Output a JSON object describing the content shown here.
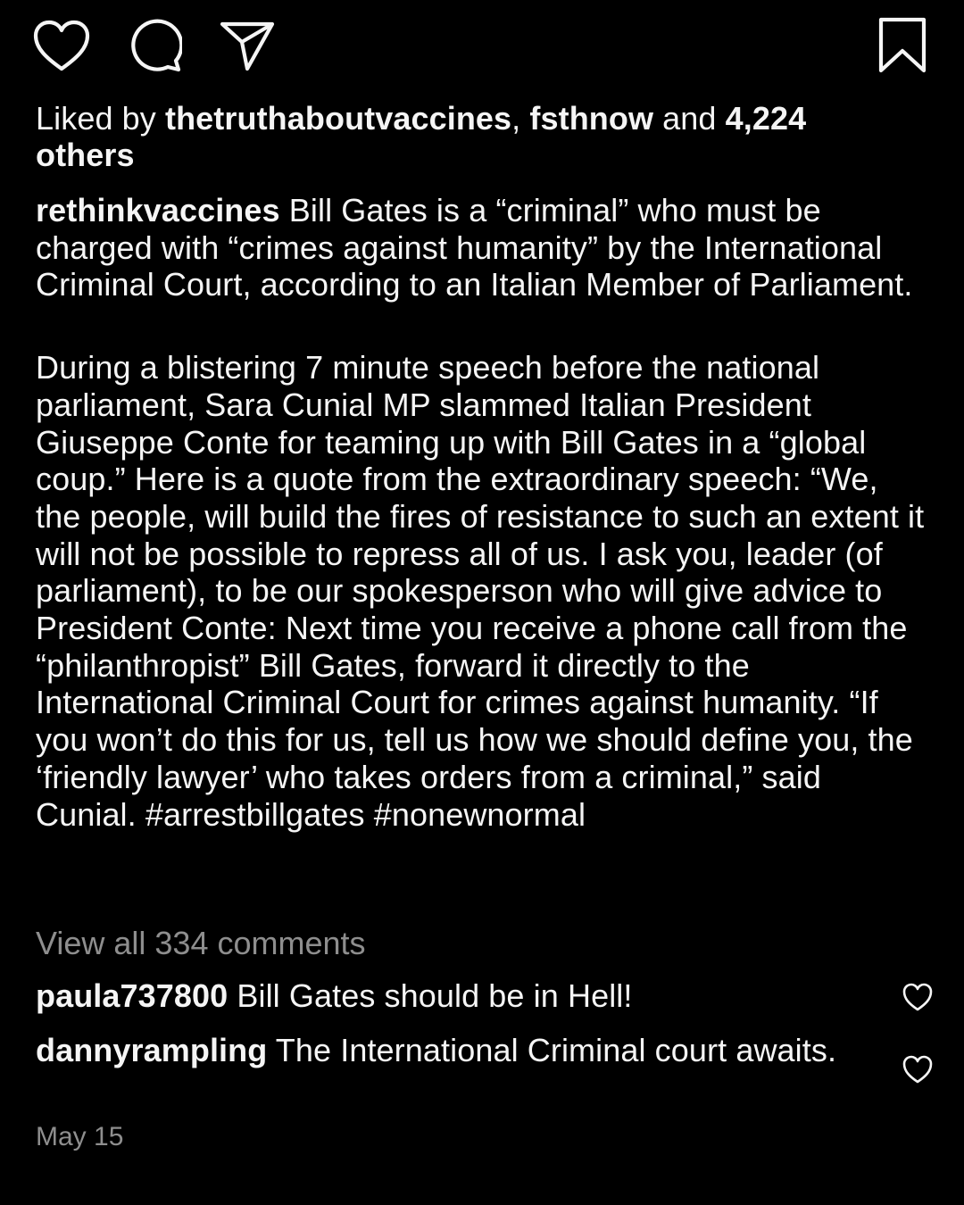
{
  "actions": {
    "like_icon": "heart-outline-icon",
    "comment_icon": "speech-bubble-icon",
    "share_icon": "paper-plane-icon",
    "save_icon": "bookmark-icon"
  },
  "likes": {
    "prefix": "Liked by ",
    "user_1": "thetruthaboutvaccines",
    "separator": ", ",
    "user_2": "fsthnow",
    "middle": " and ",
    "count_text": "4,224 others"
  },
  "caption": {
    "username": "rethinkvaccines",
    "paragraph_1": " Bill Gates is a “criminal” who must be charged with “crimes against humanity” by the International Criminal Court, according to an Italian Member of Parliament.",
    "paragraph_2": "During a blistering 7 minute speech before the national parliament, Sara Cunial MP slammed Italian President Giuseppe Conte for teaming up with Bill Gates in a “global coup.” Here is a quote from the extraordinary speech: “We, the people, will build the fires of resistance to such an extent it will not be possible to repress all of us. I ask you, leader (of parliament), to be our spokesperson who will give advice to President Conte: Next time you receive a phone call from the “philanthropist” Bill Gates, forward it directly to the International Criminal Court for crimes against humanity. “If you won’t do this for us, tell us how we should define you, the ‘friendly lawyer’ who takes orders from a criminal,” said Cunial. ",
    "hashtag_1": "#arrestbillgates",
    "hashtag_space": " ",
    "hashtag_2": "#nonewnormal"
  },
  "view_all_comments": "View all 334 comments",
  "comments": [
    {
      "username": "paula737800",
      "text": " Bill Gates should be in Hell!"
    },
    {
      "username": "dannyrampling",
      "text": " The International Criminal court awaits."
    }
  ],
  "date": "May 15",
  "colors": {
    "background": "#000000",
    "text": "#f5f5f5",
    "muted": "#8e8e8e",
    "hashtag": "#d6e6ff"
  }
}
